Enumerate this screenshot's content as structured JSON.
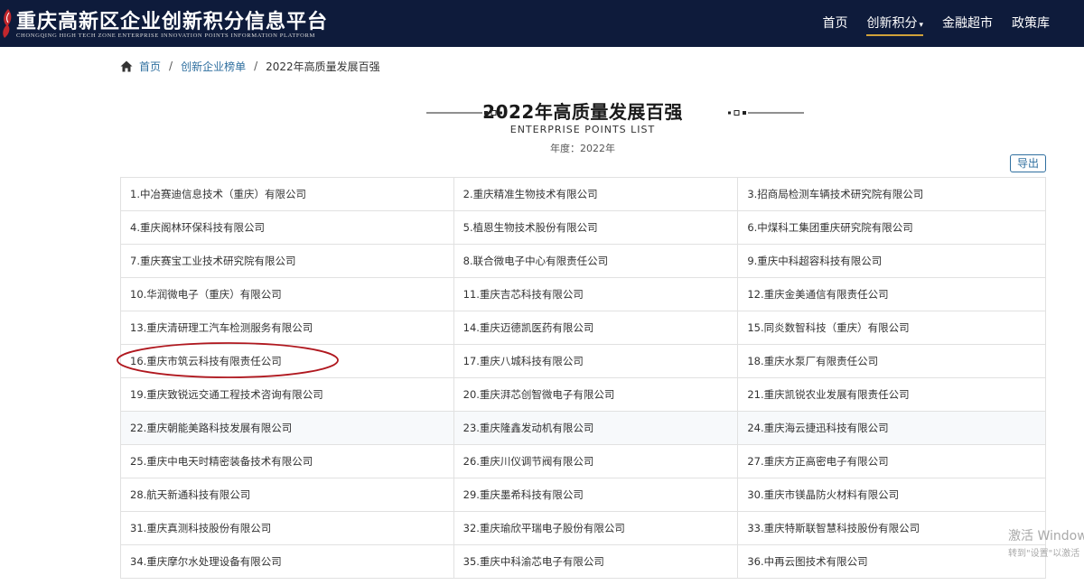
{
  "header": {
    "site_title": "重庆高新区企业创新积分信息平台",
    "site_subtitle": "CHONGQING HIGH TECH ZONE ENTERPRISE INNOVATION POINTS INFORMATION PLATFORM",
    "nav": [
      {
        "label": "首页"
      },
      {
        "label": "创新积分",
        "caret": "▾"
      },
      {
        "label": "金融超市"
      },
      {
        "label": "政策库"
      }
    ],
    "brand_color": "#0e1b3b",
    "accent_color": "#d0a23a"
  },
  "breadcrumb": {
    "home": "首页",
    "sep1": "/",
    "list": "创新企业榜单",
    "sep2": "/",
    "current": "2022年高质量发展百强"
  },
  "page": {
    "title": "2022年高质量发展百强",
    "subtitle_en": "ENTERPRISE POINTS LIST",
    "year_label": "年度：2022年",
    "export_label": "导出"
  },
  "companies": [
    [
      "1.中冶赛迪信息技术（重庆）有限公司",
      "2.重庆精准生物技术有限公司",
      "3.招商局检测车辆技术研究院有限公司"
    ],
    [
      "4.重庆阁林环保科技有限公司",
      "5.植恩生物技术股份有限公司",
      "6.中煤科工集团重庆研究院有限公司"
    ],
    [
      "7.重庆赛宝工业技术研究院有限公司",
      "8.联合微电子中心有限责任公司",
      "9.重庆中科超容科技有限公司"
    ],
    [
      "10.华润微电子（重庆）有限公司",
      "11.重庆吉芯科技有限公司",
      "12.重庆金美通信有限责任公司"
    ],
    [
      "13.重庆清研理工汽车检测服务有限公司",
      "14.重庆迈德凯医药有限公司",
      "15.同炎数智科技（重庆）有限公司"
    ],
    [
      "16.重庆市筑云科技有限责任公司",
      "17.重庆八城科技有限公司",
      "18.重庆水泵厂有限责任公司"
    ],
    [
      "19.重庆致锐远交通工程技术咨询有限公司",
      "20.重庆湃芯创智微电子有限公司",
      "21.重庆凯锐农业发展有限责任公司"
    ],
    [
      "22.重庆朝能美路科技发展有限公司",
      "23.重庆隆鑫发动机有限公司",
      "24.重庆海云捷迅科技有限公司"
    ],
    [
      "25.重庆中电天时精密装备技术有限公司",
      "26.重庆川仪调节阀有限公司",
      "27.重庆方正高密电子有限公司"
    ],
    [
      "28.航天新通科技有限公司",
      "29.重庆墨希科技有限公司",
      "30.重庆市镁晶防火材料有限公司"
    ],
    [
      "31.重庆真测科技股份有限公司",
      "32.重庆瑜欣平瑞电子股份有限公司",
      "33.重庆特斯联智慧科技股份有限公司"
    ],
    [
      "34.重庆摩尔水处理设备有限公司",
      "35.重庆中科渝芯电子有限公司",
      "36.中再云图技术有限公司"
    ]
  ],
  "highlighted_row": 5,
  "annotation_color": "#b0181f",
  "watermark": {
    "line1": "激活 Window",
    "line2": "转到\"设置\"以激活"
  }
}
